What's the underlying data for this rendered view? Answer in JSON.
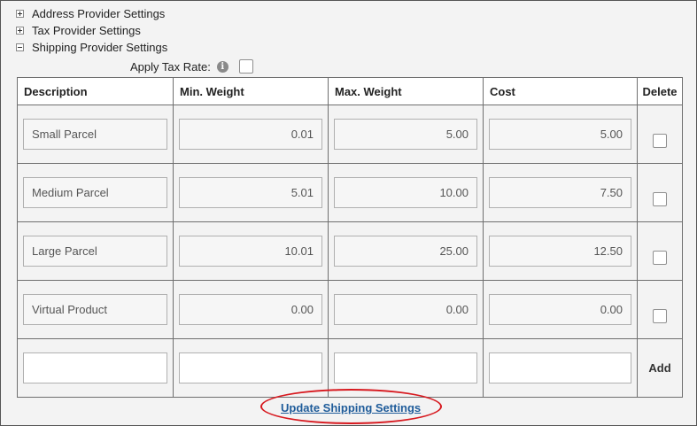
{
  "tree": {
    "items": [
      {
        "label": "Address Provider Settings",
        "expanded": false,
        "icon": "plus-square-icon"
      },
      {
        "label": "Tax Provider Settings",
        "expanded": false,
        "icon": "plus-square-icon"
      },
      {
        "label": "Shipping Provider Settings",
        "expanded": true,
        "icon": "minus-square-icon"
      }
    ]
  },
  "apply_tax": {
    "label": "Apply Tax Rate:",
    "info_icon": "info-icon",
    "checked": false
  },
  "table": {
    "headers": [
      "Description",
      "Min. Weight",
      "Max. Weight",
      "Cost",
      "Delete"
    ],
    "rows": [
      {
        "description": "Small Parcel",
        "min_weight": "0.01",
        "max_weight": "5.00",
        "cost": "5.00",
        "delete": false
      },
      {
        "description": "Medium Parcel",
        "min_weight": "5.01",
        "max_weight": "10.00",
        "cost": "7.50",
        "delete": false
      },
      {
        "description": "Large Parcel",
        "min_weight": "10.01",
        "max_weight": "25.00",
        "cost": "12.50",
        "delete": false
      },
      {
        "description": "Virtual Product",
        "min_weight": "0.00",
        "max_weight": "0.00",
        "cost": "0.00",
        "delete": false
      }
    ],
    "new_row": {
      "description": "",
      "min_weight": "",
      "max_weight": "",
      "cost": "",
      "add_label": "Add"
    }
  },
  "update_link": "Update Shipping Settings",
  "colors": {
    "link": "#1f5c9a",
    "highlight": "#d7191f",
    "background": "#f3f3f3"
  }
}
